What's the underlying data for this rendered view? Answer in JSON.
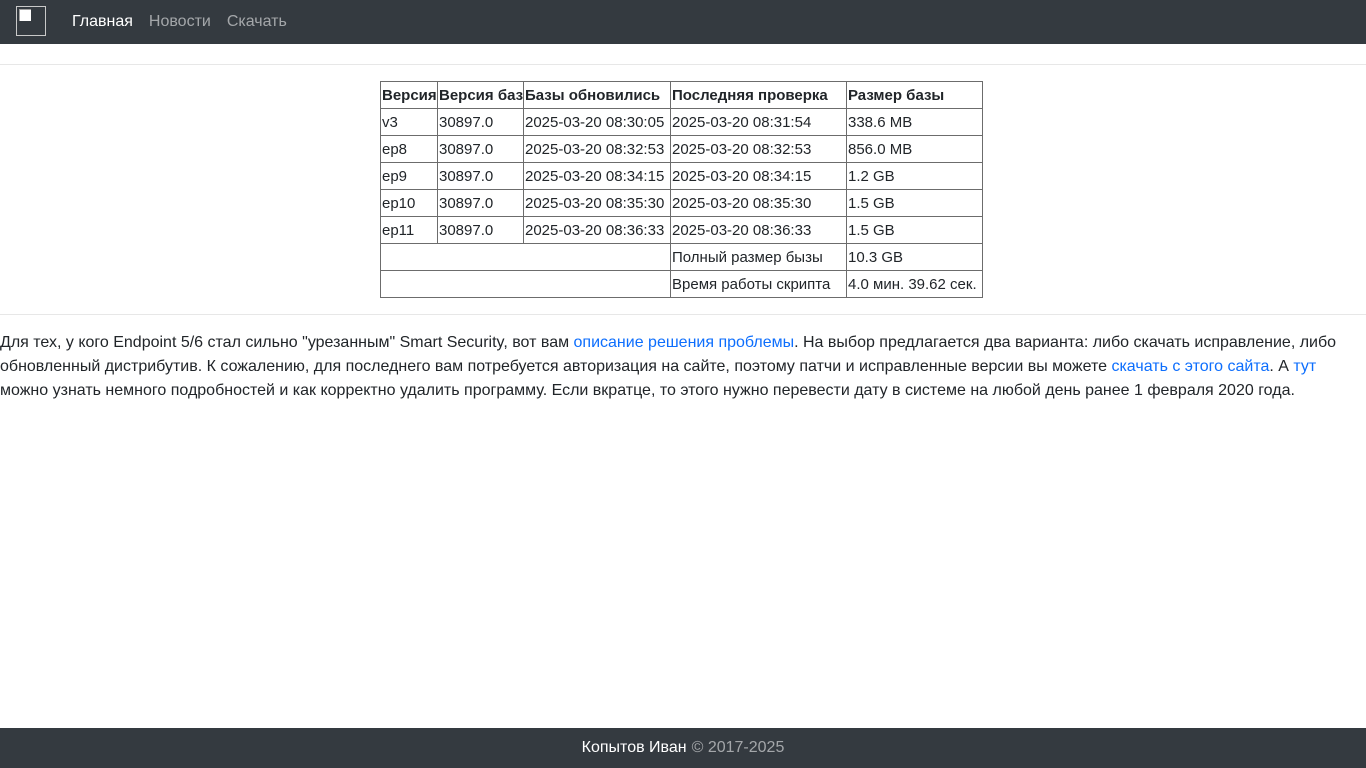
{
  "nav": {
    "logo_icon": "broken-image-icon",
    "items": [
      {
        "label": "Главная",
        "active": true
      },
      {
        "label": "Новости",
        "active": false
      },
      {
        "label": "Скачать",
        "active": false
      }
    ]
  },
  "table": {
    "headers": [
      "Версия",
      "Версия баз",
      "Базы обновились",
      "Последняя проверка",
      "Размер базы"
    ],
    "rows": [
      [
        "v3",
        "30897.0",
        "2025-03-20 08:30:05",
        "2025-03-20 08:31:54",
        "338.6 MB"
      ],
      [
        "ep8",
        "30897.0",
        "2025-03-20 08:32:53",
        "2025-03-20 08:32:53",
        "856.0 MB"
      ],
      [
        "ep9",
        "30897.0",
        "2025-03-20 08:34:15",
        "2025-03-20 08:34:15",
        "1.2 GB"
      ],
      [
        "ep10",
        "30897.0",
        "2025-03-20 08:35:30",
        "2025-03-20 08:35:30",
        "1.5 GB"
      ],
      [
        "ep11",
        "30897.0",
        "2025-03-20 08:36:33",
        "2025-03-20 08:36:33",
        "1.5 GB"
      ]
    ],
    "total_size_label": "Полный размер бызы",
    "total_size_value": "10.3 GB",
    "runtime_label": "Время работы скрипта",
    "runtime_value": "4.0 мин. 39.62 сек."
  },
  "description": {
    "part1": "Для тех, у кого Endpoint 5/6 стал сильно \"урезанным\" Smart Security, вот вам ",
    "link1": "описание решения проблемы",
    "part2": ". На выбор предлагается два варианта: либо скачать исправление, либо обновленный дистрибутив. К сожалению, для последнего вам потребуется авторизация на сайте, поэтому патчи и исправленные версии вы можете ",
    "link2": "скачать с этого сайта",
    "part3": ". А ",
    "link3": "тут",
    "part4": " можно узнать немного подробностей и как корректно удалить программу. Если вкратце, то этого нужно перевести дату в системе на любой день ранее 1 февраля 2020 года."
  },
  "footer": {
    "author": "Копытов Иван",
    "copyright": "© 2017-2025"
  },
  "colors": {
    "navbar_bg": "#343a40",
    "link": "#0d6efd",
    "nav_active": "#ffffff",
    "nav_inactive": "#9a9da0"
  }
}
